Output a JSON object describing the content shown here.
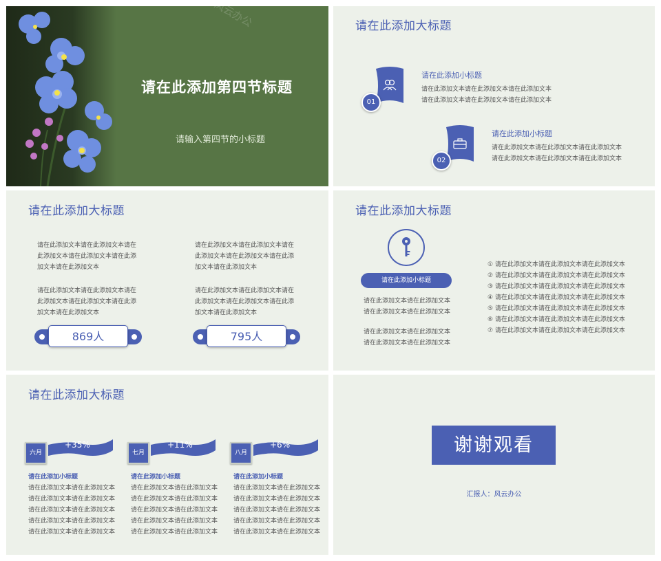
{
  "slide1": {
    "title": "请在此添加第四节标题",
    "subtitle": "请输入第四节的小标题",
    "watermark": "风云办公"
  },
  "slide2": {
    "title": "请在此添加大标题",
    "items": [
      {
        "num": "01",
        "icon": "users-icon",
        "subtitle": "请在此添加小标题",
        "lines": [
          "请在此添加文本请在此添加文本请在此添加文本",
          "请在此添加文本请在此添加文本请在此添加文本"
        ]
      },
      {
        "num": "02",
        "icon": "briefcase-icon",
        "subtitle": "请在此添加小标题",
        "lines": [
          "请在此添加文本请在此添加文本请在此添加文本",
          "请在此添加文本请在此添加文本请在此添加文本"
        ]
      }
    ]
  },
  "slide3": {
    "title": "请在此添加大标题",
    "columns": [
      {
        "para1": [
          "请在此添加文本请在此添加文本请在",
          "此添加文本请在此添加文本请在此添",
          "加文本请在此添加文本"
        ],
        "para2": [
          "请在此添加文本请在此添加文本请在",
          "此添加文本请在此添加文本请在此添",
          "加文本请在此添加文本"
        ],
        "count": "869人"
      },
      {
        "para1": [
          "请在此添加文本请在此添加文本请在",
          "此添加文本请在此添加文本请在此添",
          "加文本请在此添加文本"
        ],
        "para2": [
          "请在此添加文本请在此添加文本请在",
          "此添加文本请在此添加文本请在此添",
          "加文本请在此添加文本"
        ],
        "count": "795人"
      }
    ]
  },
  "slide4": {
    "title": "请在此添加大标题",
    "icon": "key-icon",
    "pill": "请在此添加小标题",
    "para1": [
      "请在此添加文本请在此添加文本",
      "请在此添加文本请在此添加文本"
    ],
    "para2": [
      "请在此添加文本请在此添加文本",
      "请在此添加文本请在此添加文本"
    ],
    "list": [
      "① 请在此添加文本请在此添加文本请在此添加文本",
      "② 请在此添加文本请在此添加文本请在此添加文本",
      "③ 请在此添加文本请在此添加文本请在此添加文本",
      "④ 请在此添加文本请在此添加文本请在此添加文本",
      "⑤ 请在此添加文本请在此添加文本请在此添加文本",
      "⑥ 请在此添加文本请在此添加文本请在此添加文本",
      "⑦ 请在此添加文本请在此添加文本请在此添加文本"
    ]
  },
  "slide5": {
    "title": "请在此添加大标题",
    "blocks": [
      {
        "month": "六月",
        "pct": "+35%",
        "subtitle": "请在此添加小标题",
        "lines": [
          "请在此添加文本请在此添加文本",
          "请在此添加文本请在此添加文本",
          "请在此添加文本请在此添加文本",
          "请在此添加文本请在此添加文本",
          "请在此添加文本请在此添加文本"
        ]
      },
      {
        "month": "七月",
        "pct": "+11%",
        "subtitle": "请在此添加小标题",
        "lines": [
          "请在此添加文本请在此添加文本",
          "请在此添加文本请在此添加文本",
          "请在此添加文本请在此添加文本",
          "请在此添加文本请在此添加文本",
          "请在此添加文本请在此添加文本"
        ]
      },
      {
        "month": "八月",
        "pct": "+6%",
        "subtitle": "请在此添加小标题",
        "lines": [
          "请在此添加文本请在此添加文本",
          "请在此添加文本请在此添加文本",
          "请在此添加文本请在此添加文本",
          "请在此添加文本请在此添加文本",
          "请在此添加文本请在此添加文本"
        ]
      }
    ]
  },
  "slide6": {
    "thanks": "谢谢观看",
    "reporter": "汇报人：风云办公"
  },
  "colors": {
    "accent": "#4b60b3",
    "slide_bg": "#edf1ea",
    "cover_green": "#577545"
  }
}
